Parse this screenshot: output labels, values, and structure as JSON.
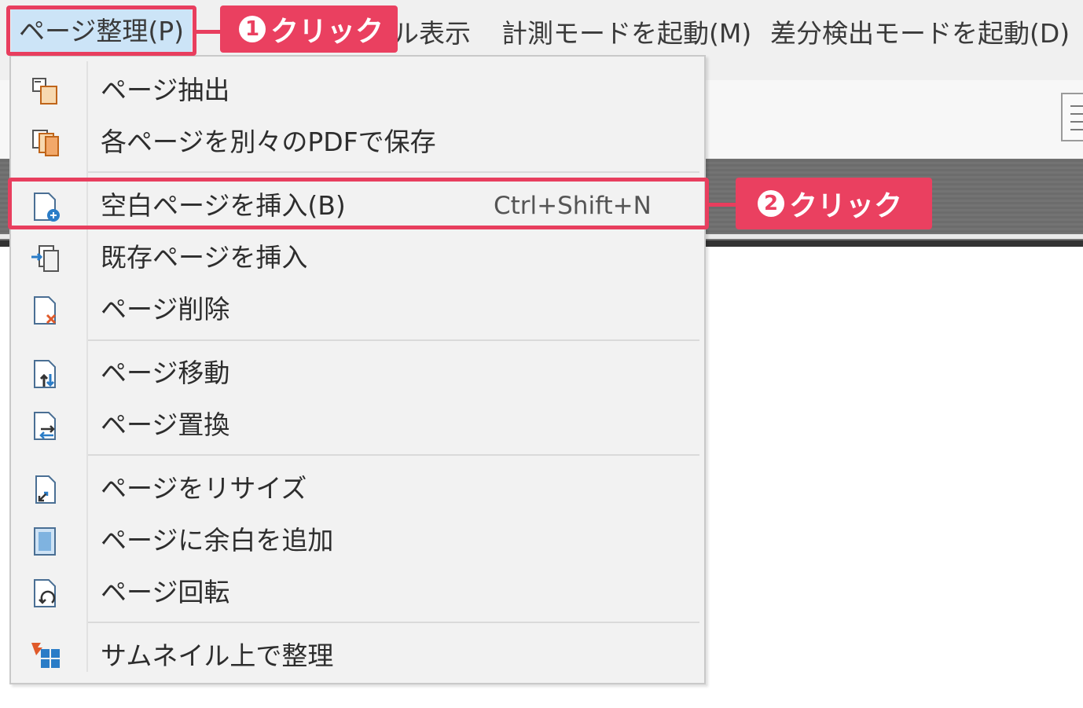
{
  "menubar": {
    "items": [
      {
        "label": "ページ整理(P)"
      },
      {
        "label": "ル表示"
      },
      {
        "label": "計測モードを起動(M)"
      },
      {
        "label": "差分検出モードを起動(D)"
      }
    ]
  },
  "menu": {
    "items": [
      {
        "label": "ページ抽出",
        "icon": "extract-page-icon"
      },
      {
        "label": "各ページを別々のPDFで保存",
        "icon": "split-pages-icon"
      },
      {
        "label": "空白ページを挿入(B)",
        "shortcut": "Ctrl+Shift+N",
        "icon": "insert-blank-page-icon"
      },
      {
        "label": "既存ページを挿入",
        "icon": "insert-existing-page-icon"
      },
      {
        "label": "ページ削除",
        "icon": "delete-page-icon"
      },
      {
        "label": "ページ移動",
        "icon": "move-page-icon"
      },
      {
        "label": "ページ置換",
        "icon": "replace-page-icon"
      },
      {
        "label": "ページをリサイズ",
        "icon": "resize-page-icon"
      },
      {
        "label": "ページに余白を追加",
        "icon": "add-margin-icon"
      },
      {
        "label": "ページ回転",
        "icon": "rotate-page-icon"
      },
      {
        "label": "サムネイル上で整理",
        "icon": "thumbnail-organize-icon"
      }
    ]
  },
  "annotations": {
    "step1": {
      "num": "1",
      "text": "クリック"
    },
    "step2": {
      "num": "2",
      "text": "クリック"
    }
  },
  "colors": {
    "highlight": "#e83e5e",
    "menubar_active": "#cce4f7",
    "menu_bg": "#f2f2f2"
  }
}
